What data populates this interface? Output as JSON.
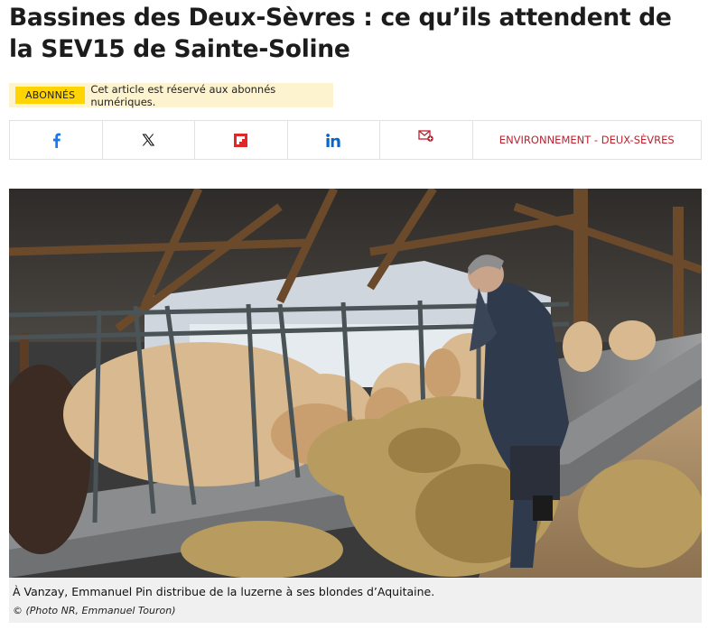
{
  "article": {
    "title": "Bassines des Deux-Sèvres : ce qu’ils attendent de la SEV15 de Sainte-Soline"
  },
  "premium": {
    "badge": "ABONNÉS",
    "note": "Cet article est réservé aux abonnés numériques."
  },
  "share": {
    "icons": [
      "facebook-icon",
      "x-icon",
      "flipboard-icon",
      "linkedin-icon",
      "mail-icon"
    ],
    "tag": "ENVIRONNEMENT - DEUX-SÈVRES"
  },
  "photo": {
    "caption": "À Vanzay, Emmanuel Pin distribue de la luzerne à ses blondes d’Aquitaine.",
    "credit": "© (Photo NR, Emmanuel Touron)"
  },
  "colors": {
    "badge": "#ffd400",
    "premium_bg": "#fdf4cf",
    "facebook": "#1877f2",
    "flipboard": "#e12828",
    "linkedin": "#0a66c2",
    "tag": "#c0202e"
  }
}
